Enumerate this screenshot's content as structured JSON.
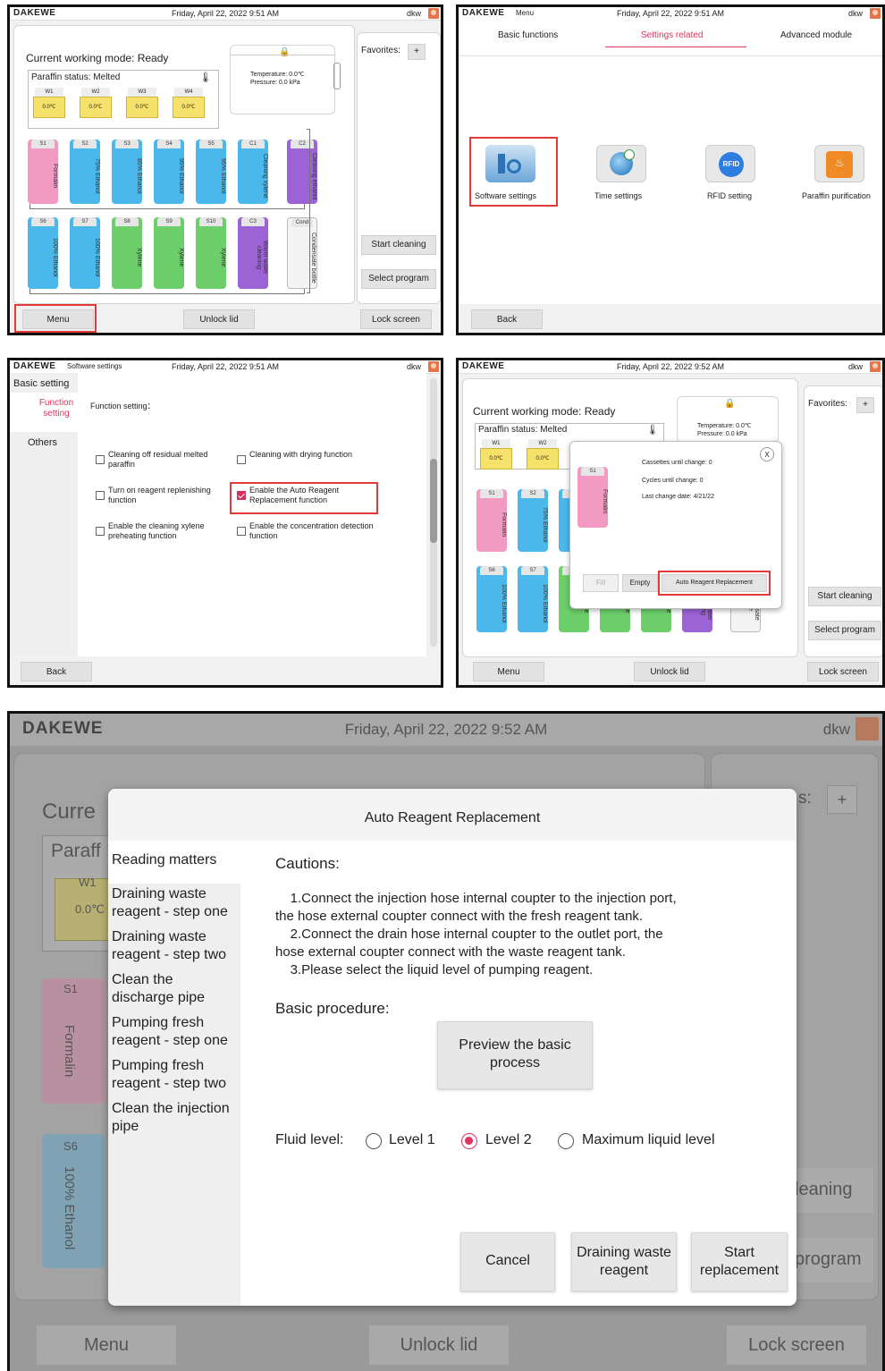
{
  "common": {
    "brand": "DAKEWE",
    "user": "dkw",
    "date_951": "Friday, April 22, 2022  9:51 AM",
    "date_952": "Friday, April 22, 2022  9:52 AM",
    "menu": "Menu",
    "unlock_lid": "Unlock lid",
    "lock_screen": "Lock screen",
    "back": "Back",
    "start_cleaning": "Start cleaning",
    "select_program": "Select program",
    "favorites": "Favorites:",
    "plus": "+"
  },
  "colors": {
    "accent": "#e0335e",
    "highlight_border": "#e03a3a",
    "formalin": "#f29ac4",
    "ethanol": "#4bb8ec",
    "xylene": "#6ccf6a",
    "cleaning": "#9c63d6",
    "wax": "#f6e26a"
  },
  "p1": {
    "working_mode": "Current working mode: Ready",
    "paraffin_status": "Paraffin status: Melted",
    "temperature": "Temperature:  0.0℃",
    "pressure": "Pressure:  0.0 kPa",
    "wax": [
      {
        "id": "W1",
        "temp": "0.0℃"
      },
      {
        "id": "W2",
        "temp": "0.0℃"
      },
      {
        "id": "W3",
        "temp": "0.0℃"
      },
      {
        "id": "W4",
        "temp": "0.0℃"
      }
    ],
    "row1": [
      {
        "id": "S1",
        "label": "Formalin",
        "kind": "formalin"
      },
      {
        "id": "S2",
        "label": "75% Ethanol",
        "kind": "ethanol"
      },
      {
        "id": "S3",
        "label": "85% Ethanol",
        "kind": "ethanol"
      },
      {
        "id": "S4",
        "label": "95% Ethanol",
        "kind": "ethanol"
      },
      {
        "id": "S5",
        "label": "95% Ethanol",
        "kind": "ethanol"
      },
      {
        "id": "C1",
        "label": "Cleaning xylene",
        "kind": "ethanol"
      },
      {
        "id": "C2",
        "label": "Cleaning ethanol",
        "kind": "cleaning"
      }
    ],
    "row2": [
      {
        "id": "S6",
        "label": "100% Ethanol",
        "kind": "ethanol"
      },
      {
        "id": "S7",
        "label": "100% Ethanol",
        "kind": "ethanol"
      },
      {
        "id": "S8",
        "label": "Xylene",
        "kind": "xylene"
      },
      {
        "id": "S9",
        "label": "Xylene",
        "kind": "xylene"
      },
      {
        "id": "S10",
        "label": "Xylene",
        "kind": "xylene"
      },
      {
        "id": "C3",
        "label": "Warm water cleaning",
        "kind": "cleaning"
      },
      {
        "id": "Cond",
        "label": "Condensate bottle",
        "kind": "cond"
      }
    ]
  },
  "p2": {
    "menu_sub": "Menu",
    "tabs": [
      "Basic functions",
      "Settings related",
      "Advanced module"
    ],
    "items": [
      {
        "label": "Software settings",
        "icon": "software-settings-icon"
      },
      {
        "label": "Time settings",
        "icon": "globe-clock-icon"
      },
      {
        "label": "RFID setting",
        "icon": "rfid-icon"
      },
      {
        "label": "Paraffin purification",
        "icon": "paraffin-heat-icon"
      }
    ]
  },
  "p3": {
    "menu_sub": "Software settings",
    "nav": [
      "Basic setting",
      "Function setting",
      "Others"
    ],
    "heading": "Function setting：",
    "options": [
      {
        "label": "Cleaning off residual melted paraffin",
        "checked": false
      },
      {
        "label": "Cleaning with drying function",
        "checked": false
      },
      {
        "label": "Turn on reagent replenishing function",
        "checked": false
      },
      {
        "label": "Enable the Auto Reagent Replacement function",
        "checked": true
      },
      {
        "label": "Enable the cleaning xylene preheating function",
        "checked": false
      },
      {
        "label": "Enable the concentration detection function",
        "checked": false
      }
    ]
  },
  "p4": {
    "popup_bottle": "S1",
    "popup_bottle_label": "Formalin",
    "cassettes": "Cassettes until change: 0",
    "cycles": "Cycles until change: 0",
    "last_change": "Last change date: 4/21/22",
    "close": "X",
    "fill": "Fill",
    "empty": "Empty",
    "auto_replace": "Auto Reagent Replacement"
  },
  "p5": {
    "dialog_title": "Auto Reagent Replacement",
    "sidebar": [
      "Reading matters",
      "Draining waste reagent - step one",
      "Draining waste reagent - step two",
      "Clean the discharge pipe",
      "Pumping fresh reagent - step one",
      "Pumping fresh reagent - step two",
      "Clean the injection pipe"
    ],
    "cautions_title": "Cautions:",
    "caution_lines": [
      "    1.Connect the injection hose internal coupter to the injection port,",
      "the hose external coupter connect with the fresh reagent tank.",
      "    2.Connect the drain hose internal coupter to the outlet port, the",
      "hose external coupter connect with the waste reagent tank.",
      "    3.Please select the liquid level of pumping reagent."
    ],
    "basic_title": "Basic procedure:",
    "preview_btn": "Preview the basic process",
    "fluid_label": "Fluid level:",
    "levels": [
      "Level 1",
      "Level 2",
      "Maximum liquid level"
    ],
    "selected_level": "Level 2",
    "cancel": "Cancel",
    "drain_btn": "Draining waste reagent",
    "start_btn": "Start replacement",
    "bg_current": "Curre",
    "bg_paraffin": "Paraff",
    "bg_w1": "W1",
    "bg_w1_temp": "0.0℃",
    "bg_s1": "S1",
    "bg_formalin": "Formalin",
    "bg_s6": "S6",
    "bg_ethanol": "100% Ethanol",
    "bg_fav": "s:",
    "bg_cleaning": "leaning",
    "bg_program": "program"
  }
}
